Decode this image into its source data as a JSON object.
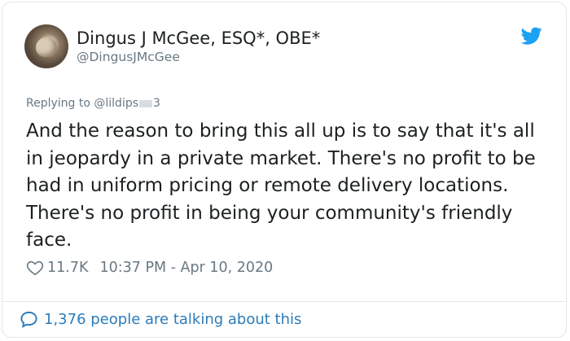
{
  "author": {
    "display_name": "Dingus J McGee, ESQ*, OBE*",
    "handle": "@DingusJMcGee"
  },
  "reply": {
    "prefix": "Replying to ",
    "handle_start": "@lildips",
    "handle_end": "3"
  },
  "tweet": {
    "text": "And the reason to bring this all up is to say that it's all in jeopardy in a private market. There's no profit to be had in uniform pricing or remote delivery locations. There's no profit in being your community's friendly face."
  },
  "meta": {
    "likes": "11.7K",
    "timestamp": "10:37 PM - Apr 10, 2020"
  },
  "footer": {
    "conversation": "1,376 people are talking about this"
  },
  "colors": {
    "brand": "#1da1f2",
    "link": "#2b7bb9",
    "muted": "#697882"
  },
  "icons": {
    "logo": "twitter-bird-icon",
    "like": "heart-icon",
    "conversation": "speech-bubble-icon"
  }
}
